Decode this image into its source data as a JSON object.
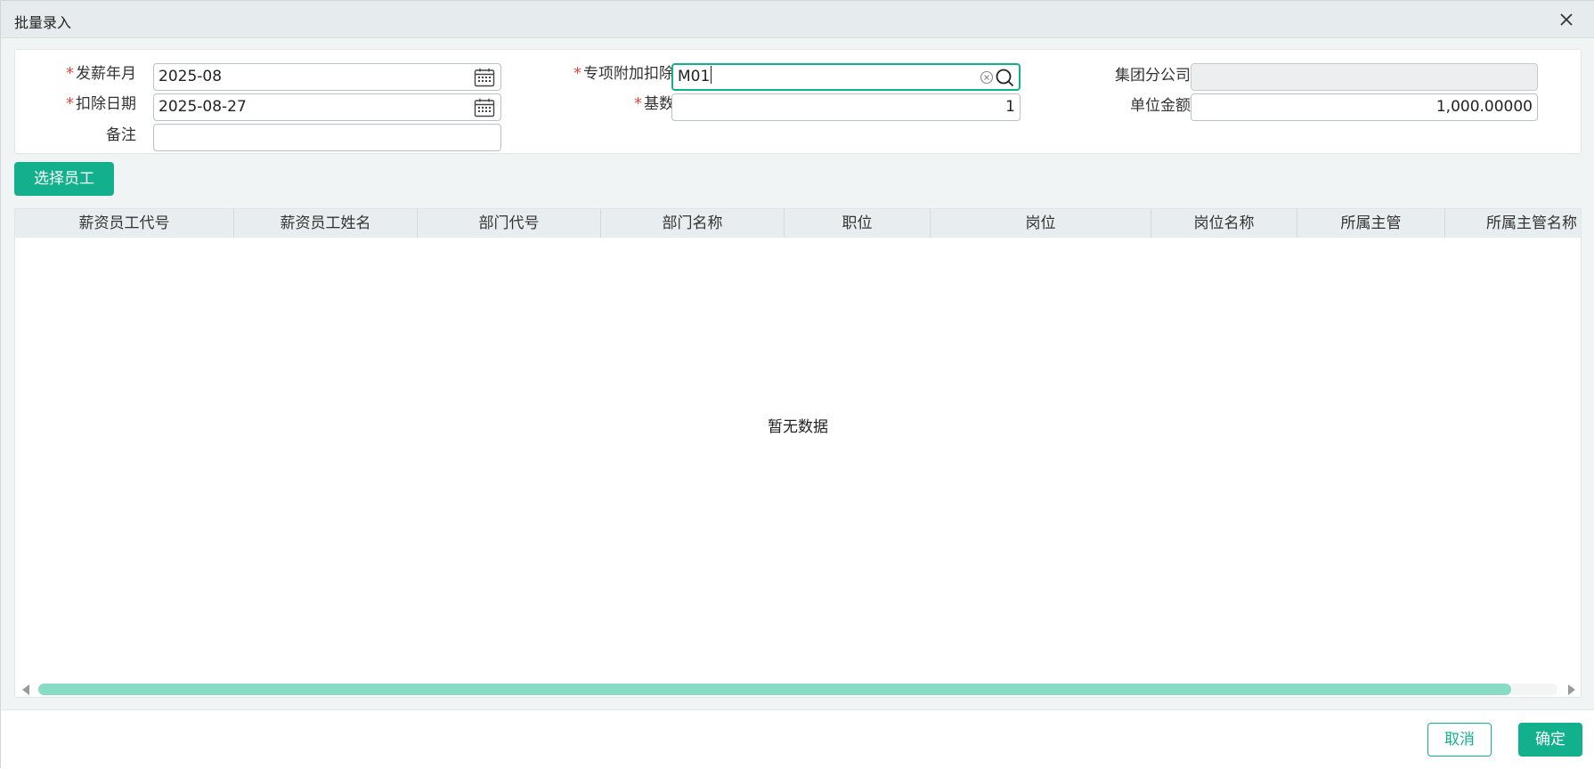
{
  "dialog": {
    "title": "批量录入"
  },
  "form": {
    "pay_month": {
      "label": "发薪年月",
      "value": "2025-08",
      "required": "*"
    },
    "special_deduction": {
      "label": "专项附加扣除",
      "value": "M01",
      "required": "*"
    },
    "group_branch": {
      "label": "集团分公司",
      "value": ""
    },
    "deduction_date": {
      "label": "扣除日期",
      "value": "2025-08-27",
      "required": "*"
    },
    "base": {
      "label": "基数",
      "value": "1",
      "required": "*"
    },
    "unit_amount": {
      "label": "单位金额",
      "value": "1,000.00000"
    },
    "remark": {
      "label": "备注",
      "value": ""
    }
  },
  "toolbar": {
    "select_employee": "选择员工"
  },
  "grid": {
    "columns": [
      "薪资员工代号",
      "薪资员工姓名",
      "部门代号",
      "部门名称",
      "职位",
      "岗位",
      "岗位名称",
      "所属主管",
      "所属主管名称"
    ],
    "empty_text": "暂无数据"
  },
  "footer": {
    "cancel": "取消",
    "confirm": "确定"
  },
  "colors": {
    "accent": "#13b08d",
    "required": "#e5483f",
    "header_bg": "#e6ecee"
  }
}
